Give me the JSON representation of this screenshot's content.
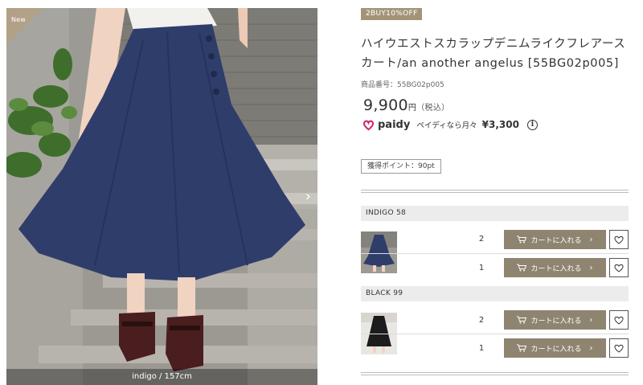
{
  "photo": {
    "new_badge": "New",
    "caption": "indigo / 157cm",
    "next_arrow": "›"
  },
  "product": {
    "promo_badge": "2BUY10%OFF",
    "title": "ハイウエストスカラップデニムライクフレアースカート/an another angelus [55BG02p005]",
    "sku": "商品番号：55BG02p005",
    "price_value": "9,900",
    "price_yen": "円",
    "price_tax": "（税込）",
    "paidy": {
      "name": "paidy",
      "text": "ペイディなら月々",
      "amount": "¥3,300",
      "info": "i",
      "brand_color": "#d6246e"
    },
    "points": "獲得ポイント：90pt"
  },
  "variants": [
    {
      "color": "INDIGO 58",
      "swatch_icon": "indigo-skirt-thumbnail",
      "rows": [
        {
          "qty": "2",
          "cart_label": "カートに入れる",
          "arrow": "›",
          "fav_icon": "heart-icon"
        },
        {
          "qty": "1",
          "cart_label": "カートに入れる",
          "arrow": "›",
          "fav_icon": "heart-icon"
        }
      ]
    },
    {
      "color": "BLACK 99",
      "swatch_icon": "black-skirt-thumbnail",
      "rows": [
        {
          "qty": "2",
          "cart_label": "カートに入れる",
          "arrow": "›",
          "fav_icon": "heart-icon"
        },
        {
          "qty": "1",
          "cart_label": "カートに入れる",
          "arrow": "›",
          "fav_icon": "heart-icon"
        }
      ]
    }
  ],
  "colors": {
    "accent": "#a39479",
    "button": "#8e8470",
    "skirt_indigo": "#2f3d6b"
  }
}
